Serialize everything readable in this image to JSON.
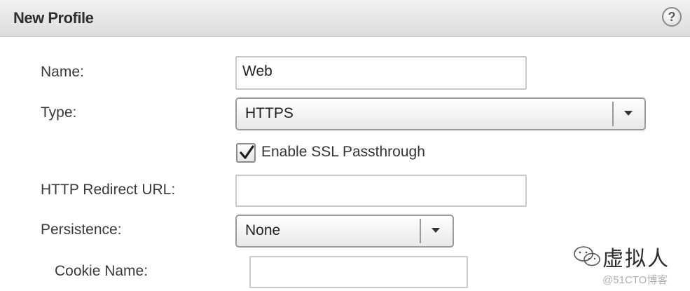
{
  "dialog": {
    "title": "New Profile",
    "help_icon": "question-circle-icon",
    "help_symbol": "?"
  },
  "form": {
    "name": {
      "label": "Name:",
      "value": "Web"
    },
    "type": {
      "label": "Type:",
      "value": "HTTPS"
    },
    "ssl_passthrough": {
      "label": "Enable SSL Passthrough",
      "checked": true
    },
    "http_redirect_url": {
      "label": "HTTP Redirect URL:",
      "value": ""
    },
    "persistence": {
      "label": "Persistence:",
      "value": "None"
    },
    "cookie_name": {
      "label": "Cookie Name:",
      "value": ""
    }
  },
  "watermark": {
    "brand": "虚拟人",
    "sub": "@51CTO博客"
  },
  "colors": {
    "header_bg": "#e6e6e6",
    "field_border": "#c9c9c9",
    "dropdown_border": "#9a9a9a"
  }
}
